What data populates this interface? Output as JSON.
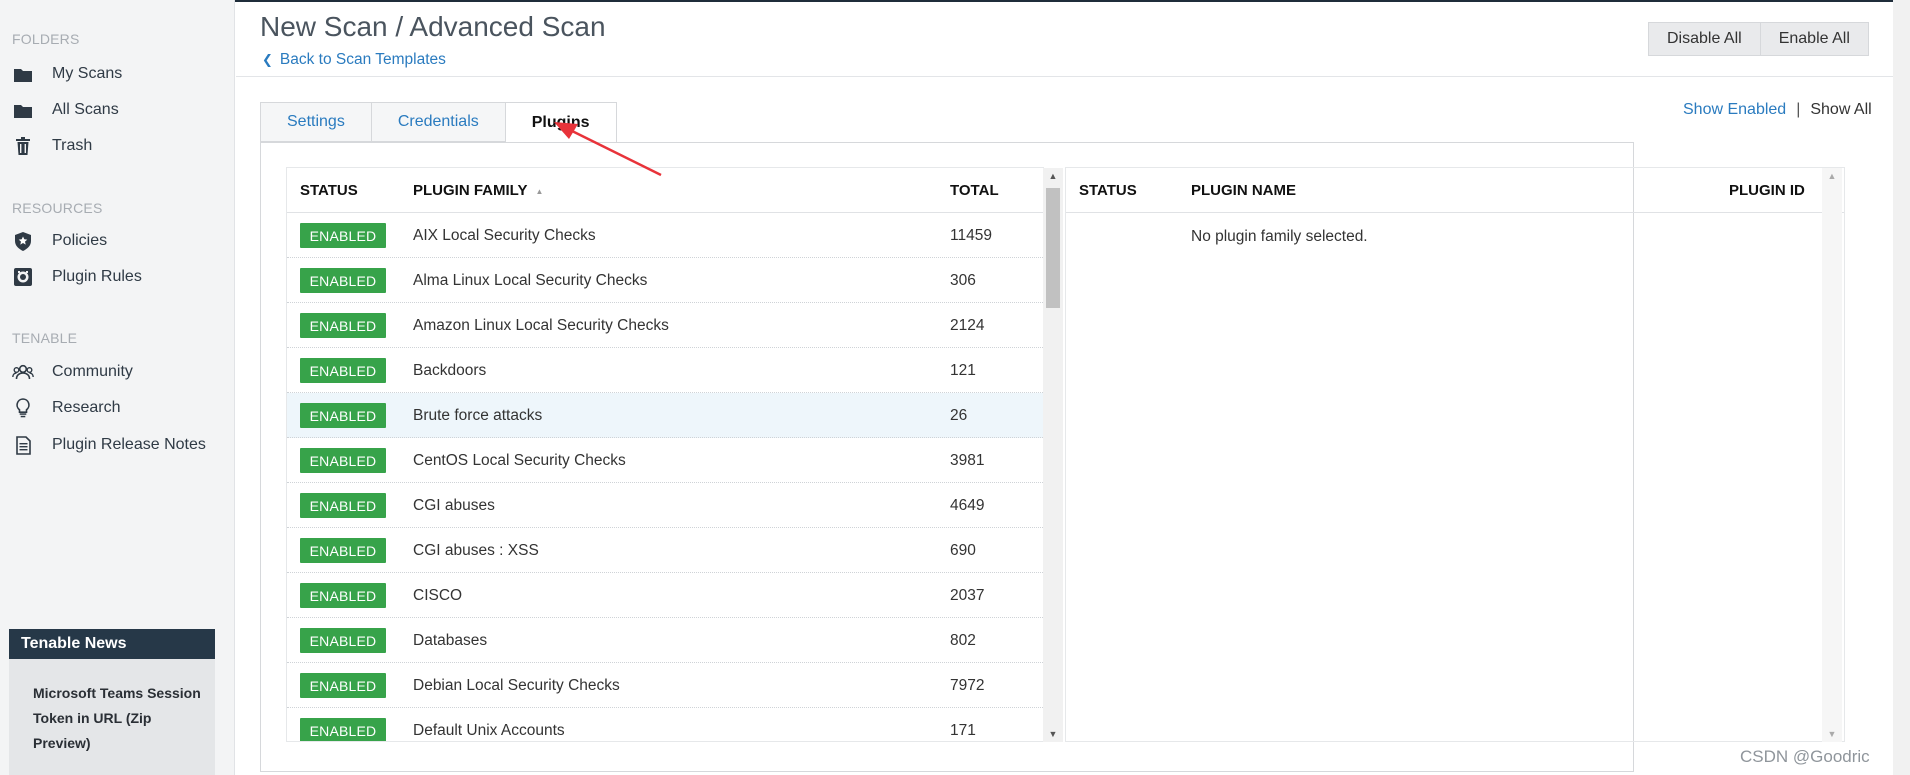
{
  "sidebar": {
    "sections": {
      "folders": "FOLDERS",
      "resources": "RESOURCES",
      "tenable": "TENABLE"
    },
    "folders": [
      {
        "label": "My Scans",
        "icon": "folder-icon"
      },
      {
        "label": "All Scans",
        "icon": "folder-icon"
      },
      {
        "label": "Trash",
        "icon": "trash-icon"
      }
    ],
    "resources": [
      {
        "label": "Policies",
        "icon": "shield-star-icon"
      },
      {
        "label": "Plugin Rules",
        "icon": "plugin-rules-icon"
      }
    ],
    "tenable": [
      {
        "label": "Community",
        "icon": "community-icon"
      },
      {
        "label": "Research",
        "icon": "lightbulb-icon"
      },
      {
        "label": "Plugin Release Notes",
        "icon": "document-icon"
      }
    ],
    "news": {
      "heading": "Tenable News",
      "headline": "Microsoft Teams Session Token in URL (Zip Preview)"
    }
  },
  "header": {
    "title": "New Scan / Advanced Scan",
    "back_link": "Back to Scan Templates",
    "disable_all": "Disable All",
    "enable_all": "Enable All"
  },
  "tabs": [
    {
      "label": "Settings",
      "active": false
    },
    {
      "label": "Credentials",
      "active": false
    },
    {
      "label": "Plugins",
      "active": true
    }
  ],
  "toggle": {
    "show_enabled": "Show Enabled",
    "separator": "|",
    "show_all": "Show All"
  },
  "families_table": {
    "columns": {
      "status": "STATUS",
      "family": "PLUGIN FAMILY",
      "total": "TOTAL"
    },
    "sorted_by": "PLUGIN FAMILY",
    "sort_direction": "ascending",
    "rows": [
      {
        "status": "ENABLED",
        "family": "AIX Local Security Checks",
        "total": "11459"
      },
      {
        "status": "ENABLED",
        "family": "Alma Linux Local Security Checks",
        "total": "306"
      },
      {
        "status": "ENABLED",
        "family": "Amazon Linux Local Security Checks",
        "total": "2124"
      },
      {
        "status": "ENABLED",
        "family": "Backdoors",
        "total": "121"
      },
      {
        "status": "ENABLED",
        "family": "Brute force attacks",
        "total": "26",
        "hover": true
      },
      {
        "status": "ENABLED",
        "family": "CentOS Local Security Checks",
        "total": "3981"
      },
      {
        "status": "ENABLED",
        "family": "CGI abuses",
        "total": "4649"
      },
      {
        "status": "ENABLED",
        "family": "CGI abuses : XSS",
        "total": "690"
      },
      {
        "status": "ENABLED",
        "family": "CISCO",
        "total": "2037"
      },
      {
        "status": "ENABLED",
        "family": "Databases",
        "total": "802"
      },
      {
        "status": "ENABLED",
        "family": "Debian Local Security Checks",
        "total": "7972"
      },
      {
        "status": "ENABLED",
        "family": "Default Unix Accounts",
        "total": "171"
      }
    ]
  },
  "plugins_table": {
    "columns": {
      "status": "STATUS",
      "name": "PLUGIN NAME",
      "id": "PLUGIN ID"
    },
    "empty_message": "No plugin family selected."
  },
  "watermark": "CSDN @Goodric",
  "colors": {
    "enabled_badge": "#37a34a",
    "link": "#2a7bbf",
    "annotation_arrow": "#e8333a",
    "news_header": "#263848"
  }
}
